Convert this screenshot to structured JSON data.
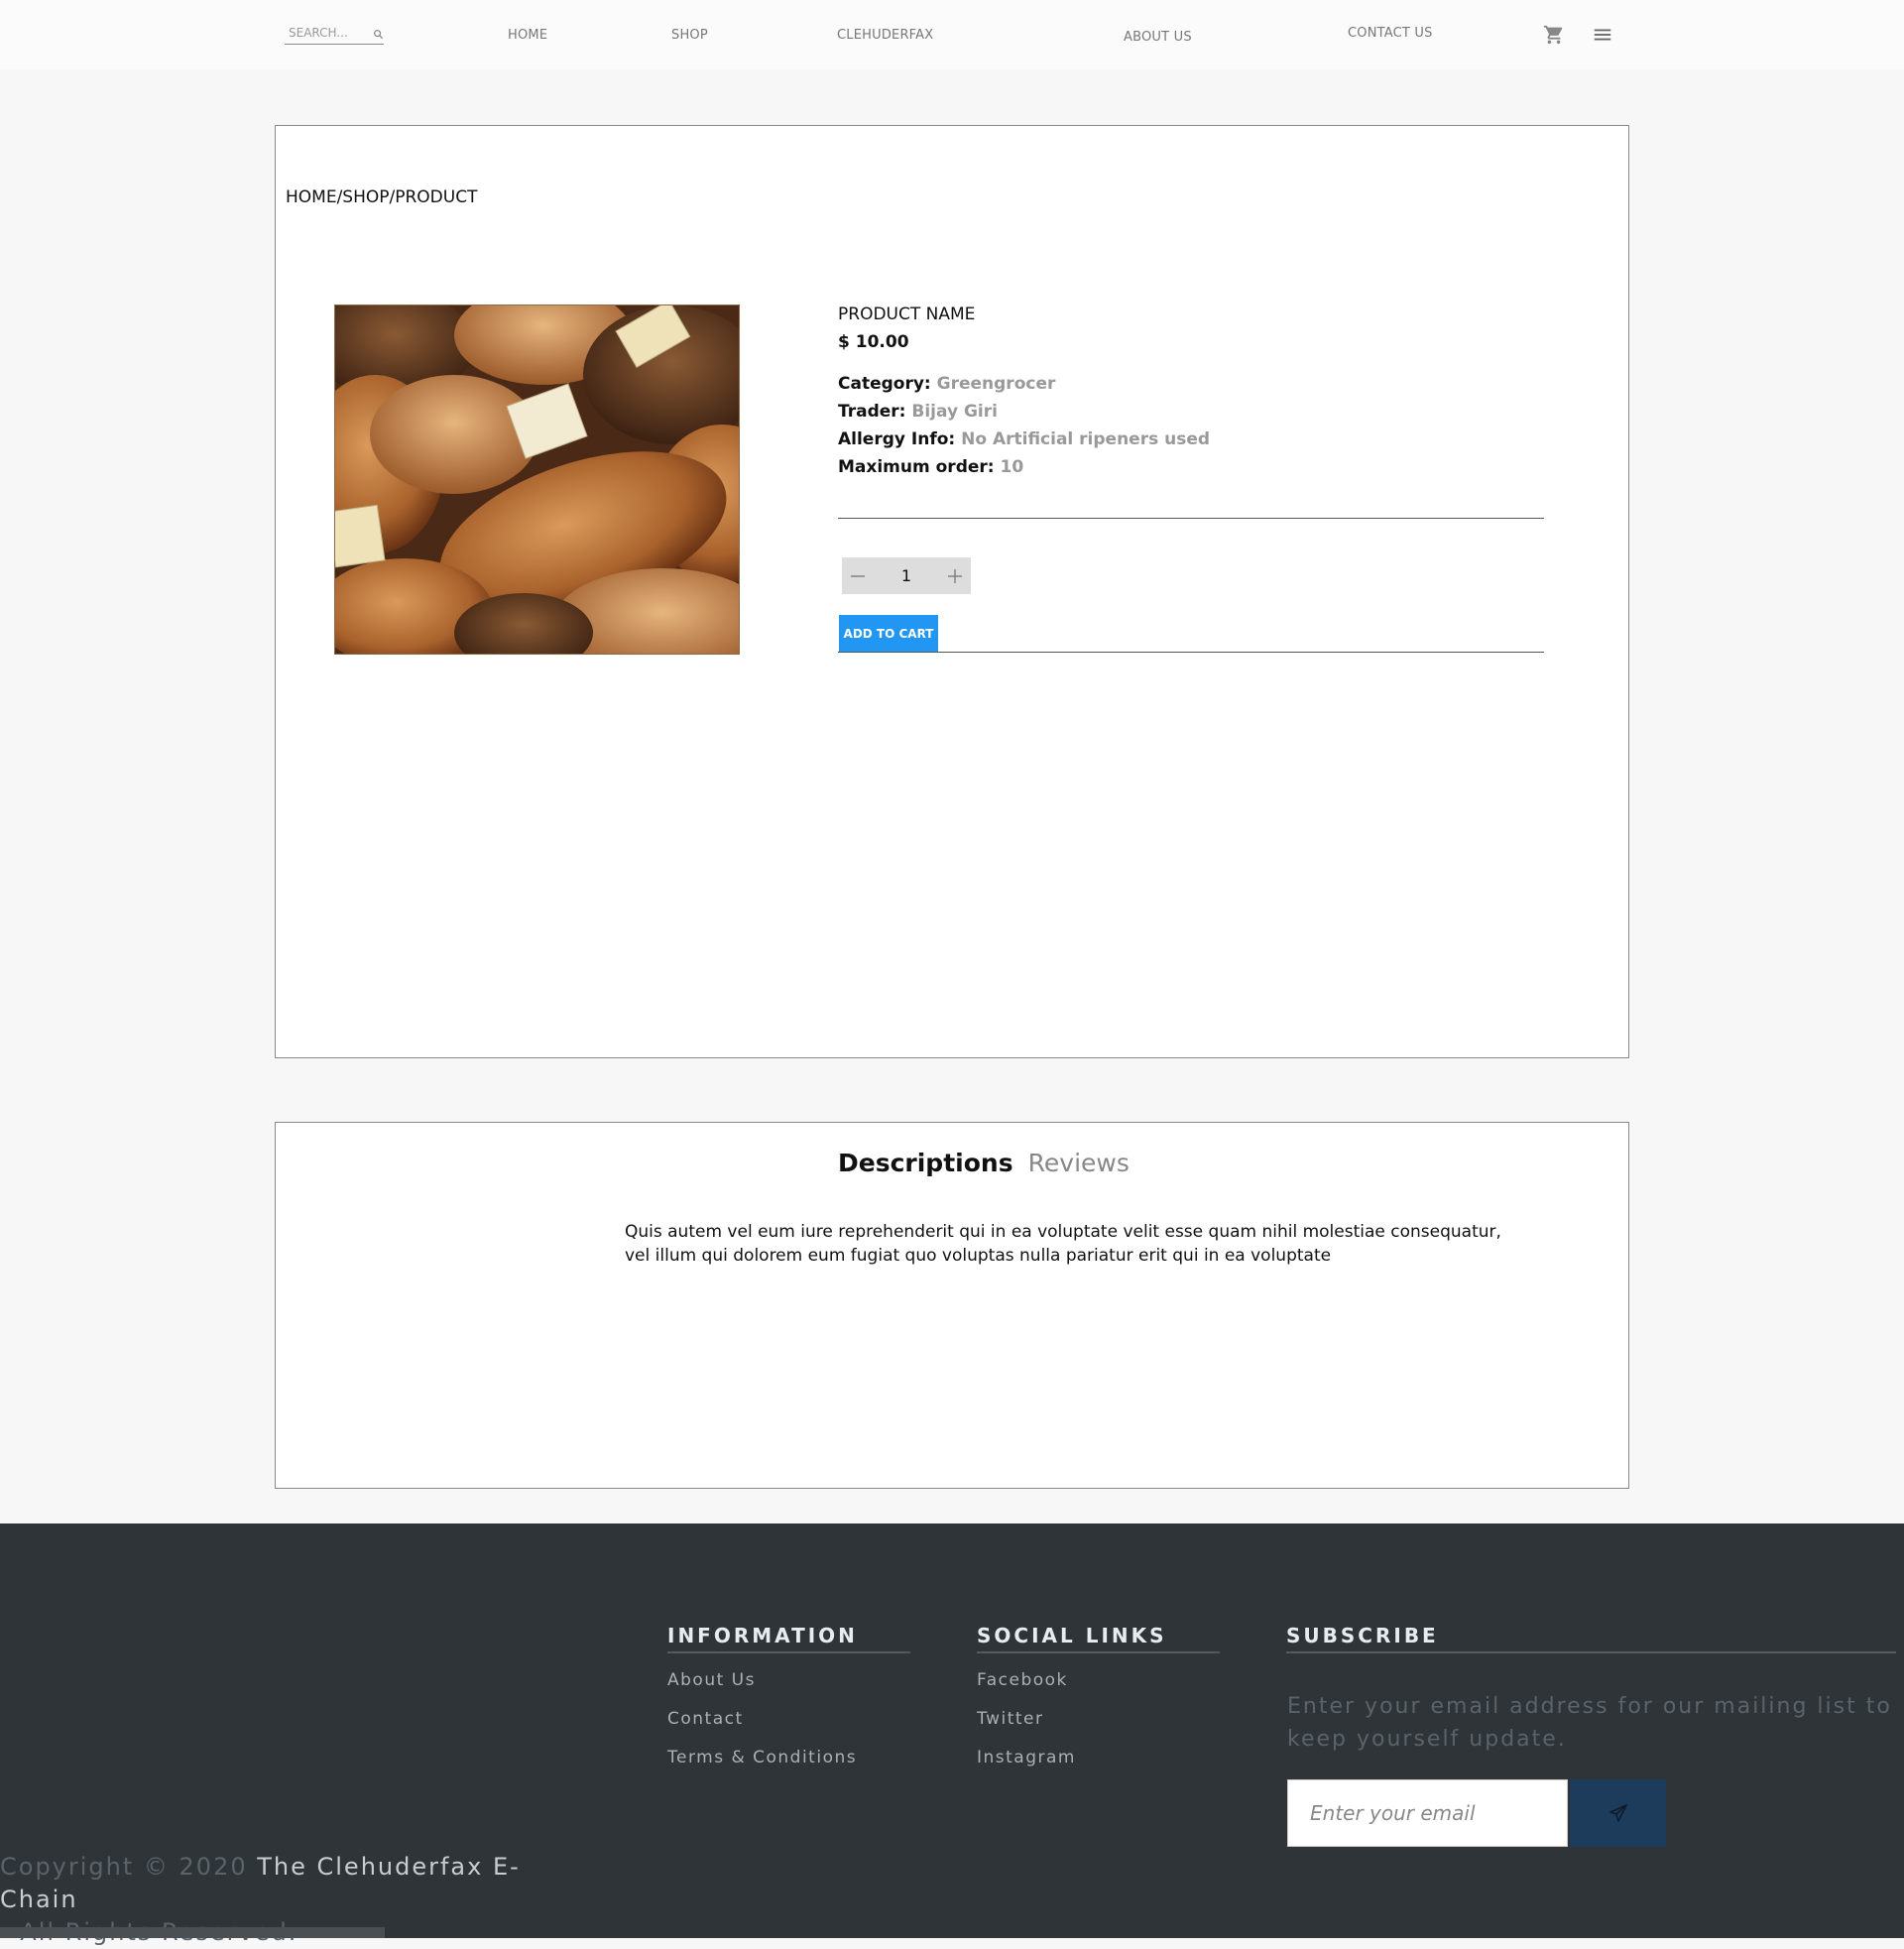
{
  "nav": {
    "search_placeholder": "SEARCH...",
    "links": [
      "HOME",
      "SHOP",
      "CLEHUDERFAX",
      "ABOUT US",
      "CONTACT US"
    ],
    "icons": [
      "search-icon",
      "cart-icon",
      "menu-icon"
    ]
  },
  "breadcrumb": "HOME/SHOP/PRODUCT",
  "product": {
    "name": "PRODUCT NAME",
    "price": "$ 10.00",
    "image_alt": "assorted bread loaves",
    "details": [
      {
        "label": "Category:",
        "value": "Greengrocer"
      },
      {
        "label": "Trader:",
        "value": "Bijay Giri"
      },
      {
        "label": "Allergy Info:",
        "value": "No Artificial ripeners used"
      },
      {
        "label": "Maximum order:",
        "value": "10"
      }
    ],
    "quantity": "1",
    "add_to_cart": "ADD TO CART"
  },
  "tabs": {
    "descriptions": "Descriptions",
    "reviews": "Reviews",
    "description_text": "Quis autem vel eum iure reprehenderit qui in ea voluptate velit esse quam nihil molestiae consequatur, vel illum qui dolorem eum fugiat quo voluptas nulla pariatur erit qui in ea voluptate"
  },
  "footer": {
    "information": {
      "heading": "INFORMATION",
      "links": [
        "About Us",
        "Contact",
        "Terms & Conditions"
      ]
    },
    "social": {
      "heading": "SOCIAL LINKS",
      "links": [
        "Facebook",
        "Twitter",
        "Instagram"
      ]
    },
    "subscribe": {
      "heading": "SUBSCRIBE",
      "text": "Enter your email address for our mailing list to keep yourself update.",
      "email_placeholder": "Enter your email"
    },
    "copyright_prefix": "Copyright © 2020 ",
    "copyright_brand": "The Clehuderfax E-Chain",
    "copyright_suffix": "- All Rights Reserved."
  },
  "colors": {
    "accent": "#2196f3",
    "footer_bg": "#2f3438",
    "send_button": "#1d3c5c",
    "muted_value": "#999999"
  }
}
